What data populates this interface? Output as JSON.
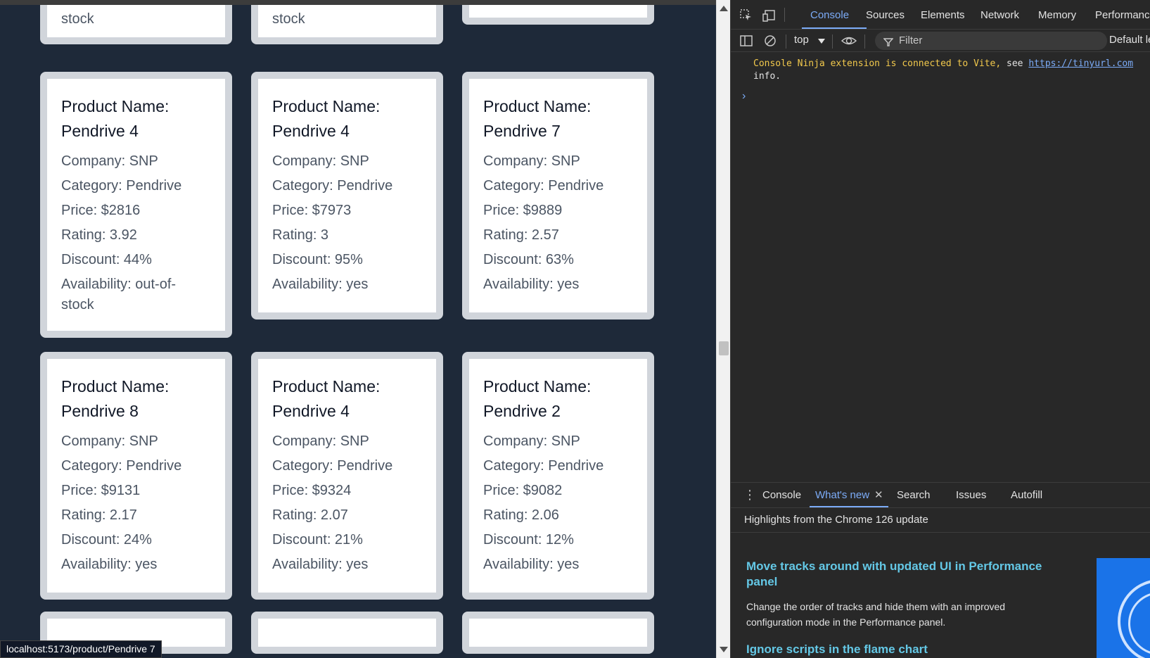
{
  "status_url": "localhost:5173/product/Pendrive 7",
  "top_partial_cards": [
    {
      "text": "stock"
    },
    {
      "text": "stock"
    },
    {
      "text": ""
    }
  ],
  "cards": [
    {
      "title_prefix": "Product Name:",
      "name": "Pendrive 4",
      "company": "Company: SNP",
      "category": "Category: Pendrive",
      "price": "Price: $2816",
      "rating": "Rating: 3.92",
      "discount": "Discount: 44%",
      "availability": "Availability: out-of-",
      "availability2": "stock"
    },
    {
      "title_prefix": "Product Name:",
      "name": "Pendrive 4",
      "company": "Company: SNP",
      "category": "Category: Pendrive",
      "price": "Price: $7973",
      "rating": "Rating: 3",
      "discount": "Discount: 95%",
      "availability": "Availability: yes",
      "availability2": ""
    },
    {
      "title_prefix": "Product Name:",
      "name": "Pendrive 7",
      "company": "Company: SNP",
      "category": "Category: Pendrive",
      "price": "Price: $9889",
      "rating": "Rating: 2.57",
      "discount": "Discount: 63%",
      "availability": "Availability: yes",
      "availability2": ""
    },
    {
      "title_prefix": "Product Name:",
      "name": "Pendrive 8",
      "company": "Company: SNP",
      "category": "Category: Pendrive",
      "price": "Price: $9131",
      "rating": "Rating: 2.17",
      "discount": "Discount: 24%",
      "availability": "Availability: yes",
      "availability2": ""
    },
    {
      "title_prefix": "Product Name:",
      "name": "Pendrive 4",
      "company": "Company: SNP",
      "category": "Category: Pendrive",
      "price": "Price: $9324",
      "rating": "Rating: 2.07",
      "discount": "Discount: 21%",
      "availability": "Availability: yes",
      "availability2": ""
    },
    {
      "title_prefix": "Product Name:",
      "name": "Pendrive 2",
      "company": "Company: SNP",
      "category": "Category: Pendrive",
      "price": "Price: $9082",
      "rating": "Rating: 2.06",
      "discount": "Discount: 12%",
      "availability": "Availability: yes",
      "availability2": ""
    }
  ],
  "devtools": {
    "tabs": [
      "Console",
      "Sources",
      "Elements",
      "Network",
      "Memory",
      "Performance"
    ],
    "active_tab": "Console",
    "context": "top",
    "filter_placeholder": "Filter",
    "levels": "Default levels",
    "console_message": {
      "text": "Console Ninja extension is connected to Vite,",
      "see": "see",
      "link": "https://tinyurl.com",
      "line2": "info."
    },
    "drawer": {
      "tabs": [
        "Console",
        "What's new",
        "Search",
        "Issues",
        "Autofill"
      ],
      "active_tab": "What's new",
      "highlights": "Highlights from the Chrome 126 update",
      "feature1_title": "Move tracks around with updated UI in Performance panel",
      "feature1_desc": "Change the order of tracks and hide them with an improved configuration mode in the Performance panel.",
      "feature2_title": "Ignore scripts in the flame chart"
    }
  }
}
